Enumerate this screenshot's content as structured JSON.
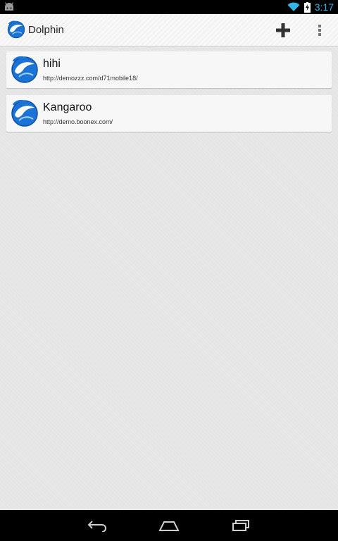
{
  "status_bar": {
    "time": "3:17",
    "icons": [
      "android-debug-icon",
      "wifi-icon",
      "battery-icon"
    ],
    "accent_color": "#33b5e5"
  },
  "action_bar": {
    "title": "Dolphin",
    "app_icon": "dolphin-logo-icon",
    "actions": [
      "add-icon",
      "overflow-menu-icon"
    ]
  },
  "bookmarks": [
    {
      "title": "hihi",
      "url": "http://demozzz.com/d71mobile18/",
      "icon": "dolphin-logo-icon"
    },
    {
      "title": "Kangaroo",
      "url": "http://demo.boonex.com/",
      "icon": "dolphin-logo-icon"
    }
  ],
  "nav_bar": {
    "buttons": [
      "back-icon",
      "home-icon",
      "recent-apps-icon"
    ]
  }
}
